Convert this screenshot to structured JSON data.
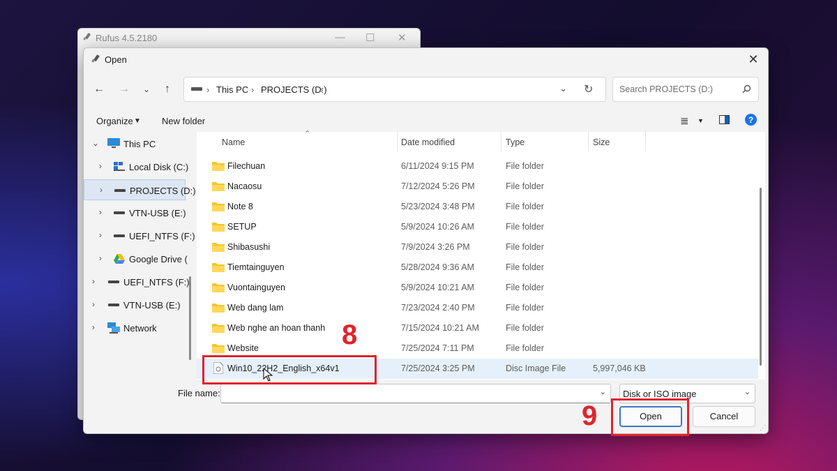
{
  "rufus": {
    "title": "Rufus 4.5.2180"
  },
  "dialog": {
    "title": "Open",
    "breadcrumb": [
      "This PC",
      "PROJECTS (D:)"
    ],
    "search_placeholder": "Search PROJECTS (D:)",
    "toolbar": {
      "organize": "Organize",
      "new_folder": "New folder"
    },
    "nav": [
      {
        "label": "This PC",
        "icon": "computer-icon"
      },
      {
        "label": "Local Disk (C:)",
        "icon": "windows-drive-icon"
      },
      {
        "label": "PROJECTS (D:)",
        "icon": "drive-icon",
        "selected": true
      },
      {
        "label": "VTN-USB (E:)",
        "icon": "drive-icon"
      },
      {
        "label": "UEFI_NTFS (F:)",
        "icon": "drive-icon"
      },
      {
        "label": "Google Drive (",
        "icon": "google-drive-icon"
      },
      {
        "label": "UEFI_NTFS (F:)",
        "icon": "drive-icon"
      },
      {
        "label": "VTN-USB (E:)",
        "icon": "drive-icon"
      },
      {
        "label": "Network",
        "icon": "network-icon"
      }
    ],
    "columns": {
      "name": "Name",
      "date": "Date modified",
      "type": "Type",
      "size": "Size"
    },
    "files": [
      {
        "name": "Filechuan",
        "date": "6/11/2024 9:15 PM",
        "type": "File folder",
        "size": ""
      },
      {
        "name": "Nacaosu",
        "date": "7/12/2024 5:26 PM",
        "type": "File folder",
        "size": ""
      },
      {
        "name": "Note 8",
        "date": "5/23/2024 3:48 PM",
        "type": "File folder",
        "size": ""
      },
      {
        "name": "SETUP",
        "date": "5/9/2024 10:26 AM",
        "type": "File folder",
        "size": ""
      },
      {
        "name": "Shibasushi",
        "date": "7/9/2024 3:26 PM",
        "type": "File folder",
        "size": ""
      },
      {
        "name": "Tiemtainguyen",
        "date": "5/28/2024 9:36 AM",
        "type": "File folder",
        "size": ""
      },
      {
        "name": "Vuontainguyen",
        "date": "5/9/2024 10:21 AM",
        "type": "File folder",
        "size": ""
      },
      {
        "name": "Web dang lam",
        "date": "7/23/2024 2:40 PM",
        "type": "File folder",
        "size": ""
      },
      {
        "name": "Web nghe an hoan thanh",
        "date": "7/15/2024 10:21 AM",
        "type": "File folder",
        "size": ""
      },
      {
        "name": "Website",
        "date": "7/25/2024 7:11 PM",
        "type": "File folder",
        "size": ""
      },
      {
        "name": "Win10_22H2_English_x64v1",
        "date": "7/25/2024 3:25 PM",
        "type": "Disc Image File",
        "size": "5,997,046 KB"
      }
    ],
    "filename_label": "File name:",
    "filename_value": "",
    "filetype": "Disk or ISO image",
    "open_button": "Open",
    "cancel_button": "Cancel"
  },
  "annotations": {
    "step8": "8",
    "step9": "9",
    "color": "#e0242b"
  },
  "colors": {
    "folder": "#f4c430",
    "selection": "#e5f0fb",
    "accent": "#0067c0"
  }
}
